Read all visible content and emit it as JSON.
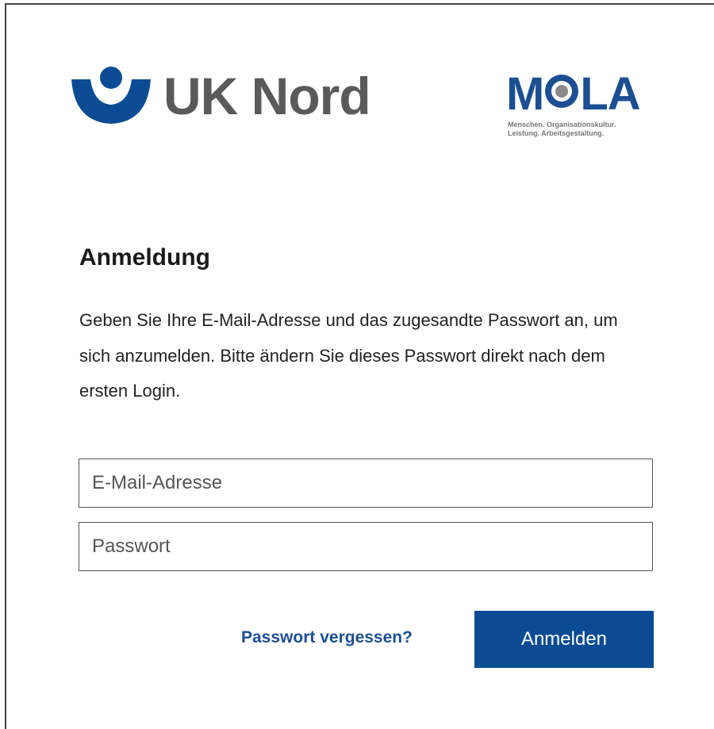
{
  "logos": {
    "uk_nord_text": "UK Nord",
    "mola_letters": [
      "M",
      "LA"
    ],
    "mola_tagline_line1": "Menschen. Organisationskultur.",
    "mola_tagline_line2": "Leistung. Arbeitsgestaltung."
  },
  "login": {
    "title": "Anmeldung",
    "intro": "Geben Sie Ihre E-Mail-Adresse und das zugesandte Passwort an, um sich anzumelden. Bitte ändern Sie dieses Passwort direkt nach dem ersten Login.",
    "email_placeholder": "E-Mail-Adresse",
    "email_value": "",
    "password_placeholder": "Passwort",
    "password_value": "",
    "forgot_label": "Passwort vergessen?",
    "submit_label": "Anmelden"
  },
  "colors": {
    "brand_blue": "#0a4b93",
    "mola_blue": "#1b4f92",
    "logo_grey": "#5a5a5a"
  }
}
